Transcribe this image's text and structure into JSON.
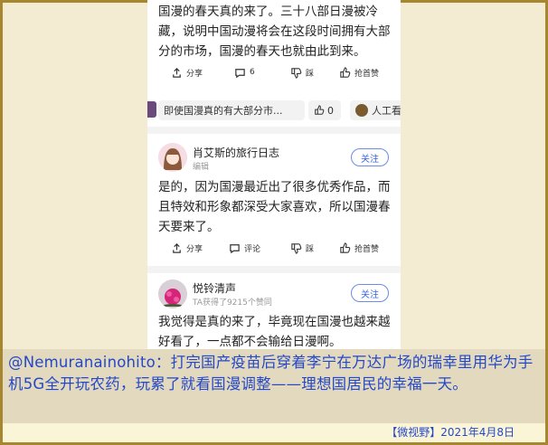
{
  "post_top": {
    "text": "国漫的春天真的来了。三十八部日漫被冷藏，说明中国动漫将会在这段时间拥有大部分的市场，国漫的春天也就由此到来。",
    "share_label": "分享",
    "comment_count": "6",
    "dislike_label": "踩",
    "like_label": "抢首赞"
  },
  "reply_strip": {
    "text": "即使国漫真的有大部分市...",
    "like_count": "0",
    "other_text": "人工看"
  },
  "comment1": {
    "username": "肖艾斯的旅行日志",
    "subtitle": "编辑",
    "follow_label": "关注",
    "text": "是的，因为国漫最近出了很多优秀作品，而且特效和形象都深受大家喜欢，所以国漫春天要来了。",
    "share_label": "分享",
    "comment_label": "评论",
    "dislike_label": "踩",
    "like_label": "抢首赞"
  },
  "comment2": {
    "username": "悦铃清声",
    "subtitle": "TA获得了9215个赞同",
    "follow_label": "关注",
    "text": "我觉得是真的来了，毕竟现在国漫也越来越好看了，一点都不会输给日漫啊。"
  },
  "caption": {
    "text": "@Nemuranainohito：打完国产疫苗后穿着李宁在万达广场的瑞幸里用华为手机5G全开玩农药，玩累了就看国漫调整——理想国居民的幸福一天。"
  },
  "footer": {
    "text": "【微视野】2021年4月8日"
  },
  "colors": {
    "frame": "#a6862e",
    "caption_text": "#2448c8",
    "follow_blue": "#3b68e0"
  }
}
